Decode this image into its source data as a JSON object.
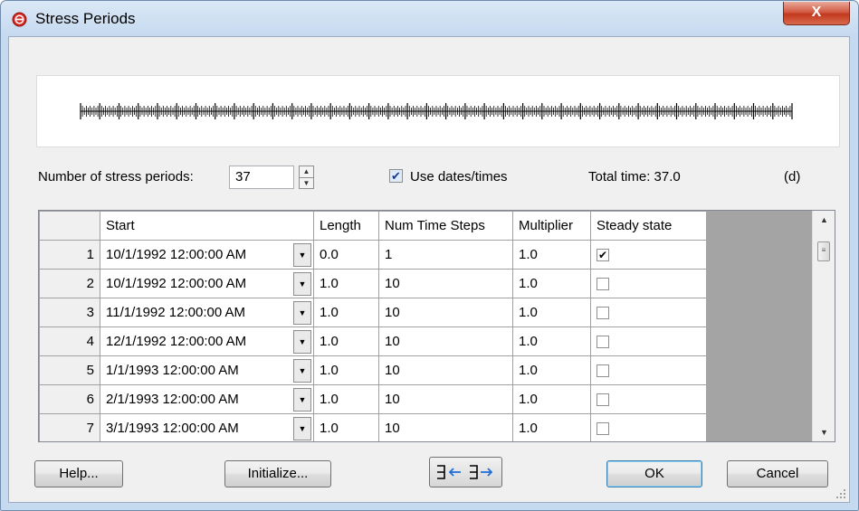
{
  "window": {
    "title": "Stress Periods",
    "close_label": "X"
  },
  "controls": {
    "num_periods_label": "Number of stress periods:",
    "num_periods_value": "37",
    "use_dates_label": "Use dates/times",
    "use_dates_checked": true,
    "total_time_label": "Total time: 37.0",
    "units_label": "(d)"
  },
  "table": {
    "columns": [
      "Start",
      "Length",
      "Num Time Steps",
      "Multiplier",
      "Steady state"
    ],
    "rows": [
      {
        "num": "1",
        "start": "10/1/1992 12:00:00 AM",
        "length": "0.0",
        "steps": "1",
        "multiplier": "1.0",
        "steady": true
      },
      {
        "num": "2",
        "start": "10/1/1992 12:00:00 AM",
        "length": "1.0",
        "steps": "10",
        "multiplier": "1.0",
        "steady": false
      },
      {
        "num": "3",
        "start": "11/1/1992 12:00:00 AM",
        "length": "1.0",
        "steps": "10",
        "multiplier": "1.0",
        "steady": false
      },
      {
        "num": "4",
        "start": "12/1/1992 12:00:00 AM",
        "length": "1.0",
        "steps": "10",
        "multiplier": "1.0",
        "steady": false
      },
      {
        "num": "5",
        "start": "1/1/1993 12:00:00 AM",
        "length": "1.0",
        "steps": "10",
        "multiplier": "1.0",
        "steady": false
      },
      {
        "num": "6",
        "start": "2/1/1993 12:00:00 AM",
        "length": "1.0",
        "steps": "10",
        "multiplier": "1.0",
        "steady": false
      },
      {
        "num": "7",
        "start": "3/1/1993 12:00:00 AM",
        "length": "1.0",
        "steps": "10",
        "multiplier": "1.0",
        "steady": false
      }
    ]
  },
  "buttons": {
    "help": "Help...",
    "initialize": "Initialize...",
    "ok": "OK",
    "cancel": "Cancel"
  },
  "icons": {
    "app": "stop-circle-icon",
    "insert_rows": "insert-rows-icon",
    "delete_rows": "delete-rows-icon"
  }
}
